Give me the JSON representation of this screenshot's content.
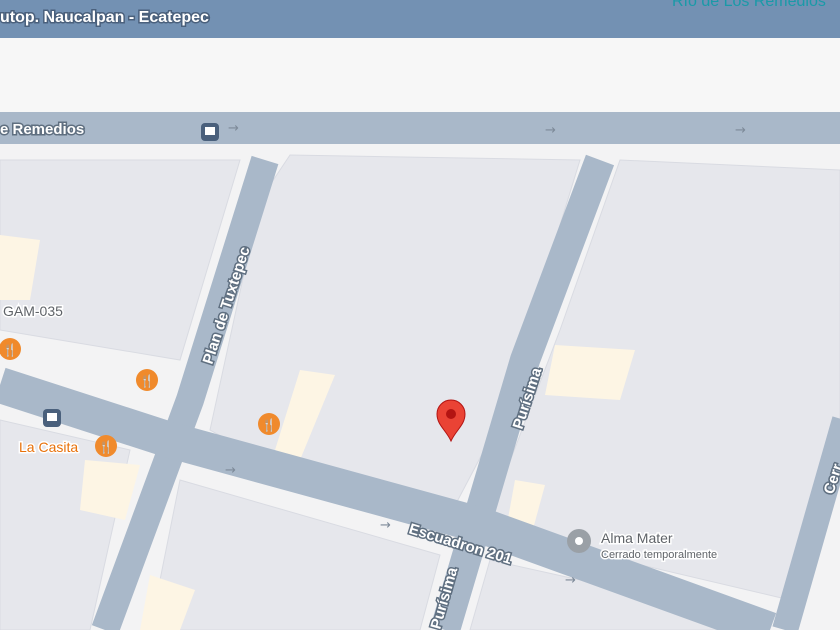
{
  "map": {
    "roads": {
      "highway_top": "utop. Naucalpan - Ecatepec",
      "highway_top_right": "Río de Los Remedios",
      "remedios": "e Remedios",
      "plan_de_tuxtepec": "Plan de Tuxtepec",
      "purisima": "Purísima",
      "purisima_bottom": "Purísima",
      "escuadron": "Escuadron 201",
      "right_road": "Cerr"
    },
    "places": [
      {
        "name": "GAM-035",
        "icon": "none"
      },
      {
        "name": "La Casita",
        "icon": "restaurant-icon"
      },
      {
        "name": "Alma Mater",
        "subtitle": "Cerrado temporalmente",
        "icon": "place-icon"
      }
    ],
    "colors": {
      "road": "#a9b8c9",
      "highway": "#7391b3",
      "poi_food": "#f08a2c",
      "pin": "#d93025",
      "building": "#e8e9ed",
      "poi_area": "#fdf6e6"
    }
  }
}
